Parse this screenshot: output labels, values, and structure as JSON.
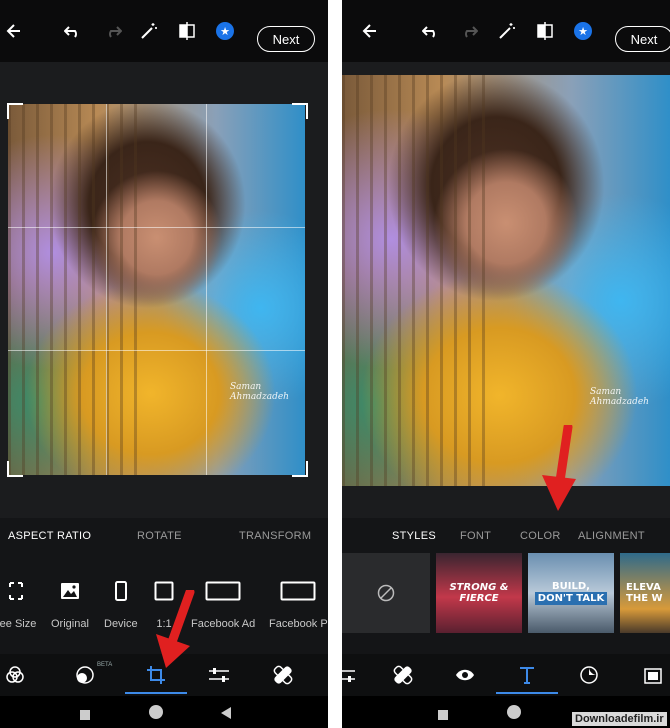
{
  "left": {
    "topbar": {
      "next_label": "Next"
    },
    "tabs": [
      "ASPECT RATIO",
      "ROTATE",
      "TRANSFORM"
    ],
    "options": [
      "ree Size",
      "Original",
      "Device",
      "1:1",
      "Facebook Ad",
      "Facebook P"
    ],
    "bottom_nav": {
      "beta_label": "BETA"
    }
  },
  "right": {
    "topbar": {
      "next_label": "Next"
    },
    "tabs": [
      "STYLES",
      "FONT",
      "COLOR",
      "ALIGNMENT"
    ],
    "thumbs": [
      {
        "line1": "STRONG &",
        "line2": "FIERCE"
      },
      {
        "line1": "BUILD,",
        "line2": "DON'T TALK"
      },
      {
        "line1": "ELEVA",
        "line2": "THE W"
      }
    ]
  },
  "photo_signature": {
    "line1": "Saman",
    "line2": "Ahmadzadeh"
  },
  "watermark": "Downloadefilm.ir",
  "colors": {
    "accent": "#3d8ae8",
    "arrow": "#e02020",
    "background": "#1b1c1e"
  }
}
